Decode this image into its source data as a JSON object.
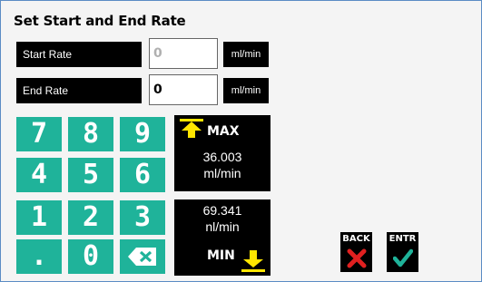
{
  "title": "Set Start and End Rate",
  "start": {
    "label": "Start Rate",
    "value": "0",
    "unit": "ml/min"
  },
  "end": {
    "label": "End Rate",
    "value": "0",
    "unit": "ml/min"
  },
  "keypad": [
    "7",
    "8",
    "9",
    "4",
    "5",
    "6",
    "1",
    "2",
    "3",
    ".",
    "0"
  ],
  "max": {
    "label": "MAX",
    "value": "36.003",
    "unit": "ml/min"
  },
  "min": {
    "label": "MIN",
    "value": "69.341",
    "unit": "nl/min"
  },
  "back": {
    "label": "BACK"
  },
  "enter": {
    "label": "ENTR"
  },
  "colors": {
    "keypad": "#1fb39a",
    "max_arrow": "#ffe600",
    "back_x": "#e02020",
    "enter_check": "#1fb39a"
  }
}
